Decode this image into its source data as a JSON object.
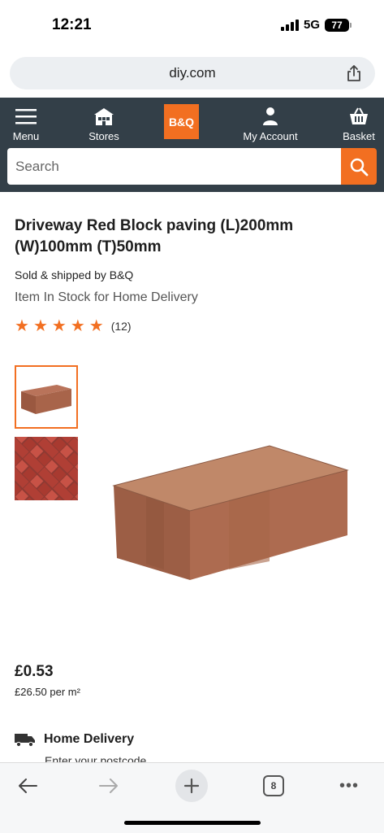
{
  "status_bar": {
    "time": "12:21",
    "network": "5G",
    "battery": "77"
  },
  "browser": {
    "url": "diy.com",
    "tab_count": "8"
  },
  "header": {
    "menu_label": "Menu",
    "stores_label": "Stores",
    "logo_text": "B&Q",
    "account_label": "My Account",
    "basket_label": "Basket",
    "search_placeholder": "Search",
    "brand_color": "#f26f21",
    "header_color": "#333f48"
  },
  "product": {
    "title": "Driveway Red Block paving (L)200mm (W)100mm (T)50mm",
    "sold_by": "Sold & shipped by B&Q",
    "stock_status": "Item In Stock for Home Delivery",
    "rating_stars": 5,
    "review_count": "(12)",
    "price": "£0.53",
    "price_per_unit": "£26.50 per m²"
  },
  "delivery": {
    "title": "Home Delivery",
    "postcode_prompt": "Enter your postcode"
  }
}
